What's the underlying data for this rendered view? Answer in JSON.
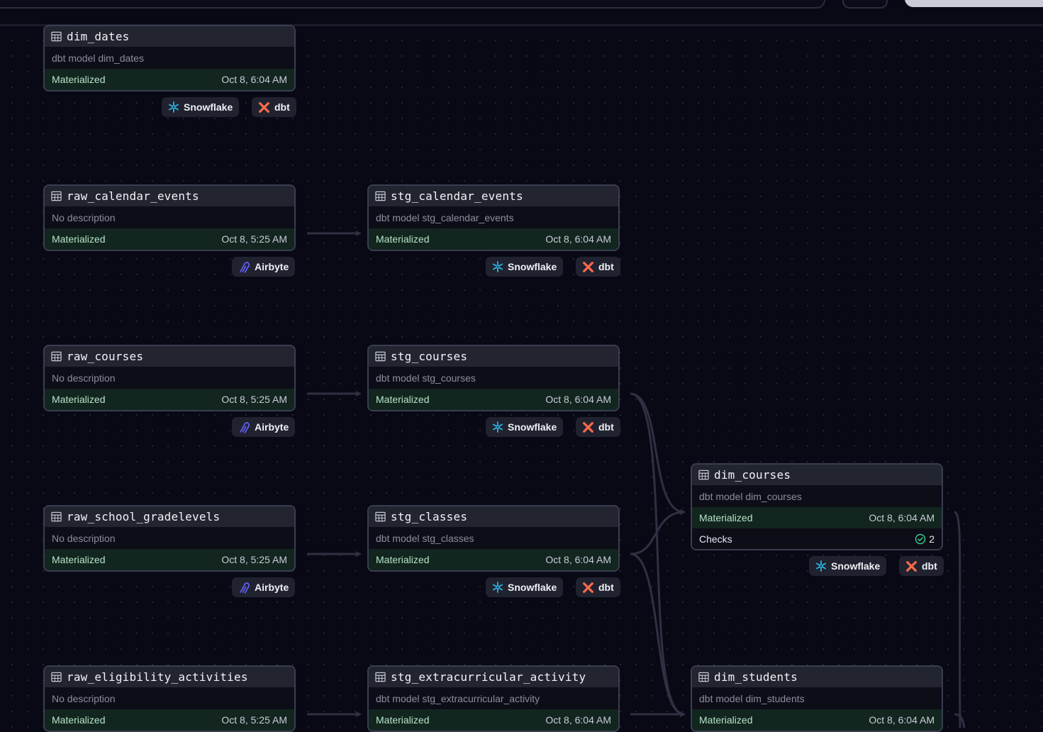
{
  "materialized_label": "Materialized",
  "checks_label": "Checks",
  "icons": {
    "table": "table-icon",
    "snowflake": "snowflake-icon",
    "dbt": "dbt-icon",
    "airbyte": "airbyte-icon",
    "check": "check-circle-icon"
  },
  "colors": {
    "snowflake": "#29b5e8",
    "dbt": "#ff694a",
    "airbyte": "#615eff",
    "materialized_bg": "#12251f",
    "check": "#3ecf8e"
  },
  "nodes": [
    {
      "id": "dim_dates",
      "title": "dim_dates",
      "desc": "dbt model dim_dates",
      "date": "Oct 8, 6:04 AM",
      "tags": [
        "Snowflake",
        "dbt"
      ]
    },
    {
      "id": "raw_calendar_events",
      "title": "raw_calendar_events",
      "desc": "No description",
      "date": "Oct 8, 5:25 AM",
      "tags": [
        "Airbyte"
      ]
    },
    {
      "id": "stg_calendar_events",
      "title": "stg_calendar_events",
      "desc": "dbt model stg_calendar_events",
      "date": "Oct 8, 6:04 AM",
      "tags": [
        "Snowflake",
        "dbt"
      ]
    },
    {
      "id": "raw_courses",
      "title": "raw_courses",
      "desc": "No description",
      "date": "Oct 8, 5:25 AM",
      "tags": [
        "Airbyte"
      ]
    },
    {
      "id": "stg_courses",
      "title": "stg_courses",
      "desc": "dbt model stg_courses",
      "date": "Oct 8, 6:04 AM",
      "tags": [
        "Snowflake",
        "dbt"
      ]
    },
    {
      "id": "dim_courses",
      "title": "dim_courses",
      "desc": "dbt model dim_courses",
      "date": "Oct 8, 6:04 AM",
      "checks": "2",
      "tags": [
        "Snowflake",
        "dbt"
      ]
    },
    {
      "id": "raw_school_gradelevels",
      "title": "raw_school_gradelevels",
      "desc": "No description",
      "date": "Oct 8, 5:25 AM",
      "tags": [
        "Airbyte"
      ]
    },
    {
      "id": "stg_classes",
      "title": "stg_classes",
      "desc": "dbt model stg_classes",
      "date": "Oct 8, 6:04 AM",
      "tags": [
        "Snowflake",
        "dbt"
      ]
    },
    {
      "id": "raw_eligibility_activities",
      "title": "raw_eligibility_activities",
      "desc": "No description",
      "date": "Oct 8, 5:25 AM",
      "tags": []
    },
    {
      "id": "stg_extracurricular_activity",
      "title": "stg_extracurricular_activity",
      "desc": "dbt model stg_extracurricular_activity",
      "date": "Oct 8, 6:04 AM",
      "tags": []
    },
    {
      "id": "dim_students",
      "title": "dim_students",
      "desc": "dbt model dim_students",
      "date": "Oct 8, 6:04 AM",
      "tags": []
    }
  ]
}
